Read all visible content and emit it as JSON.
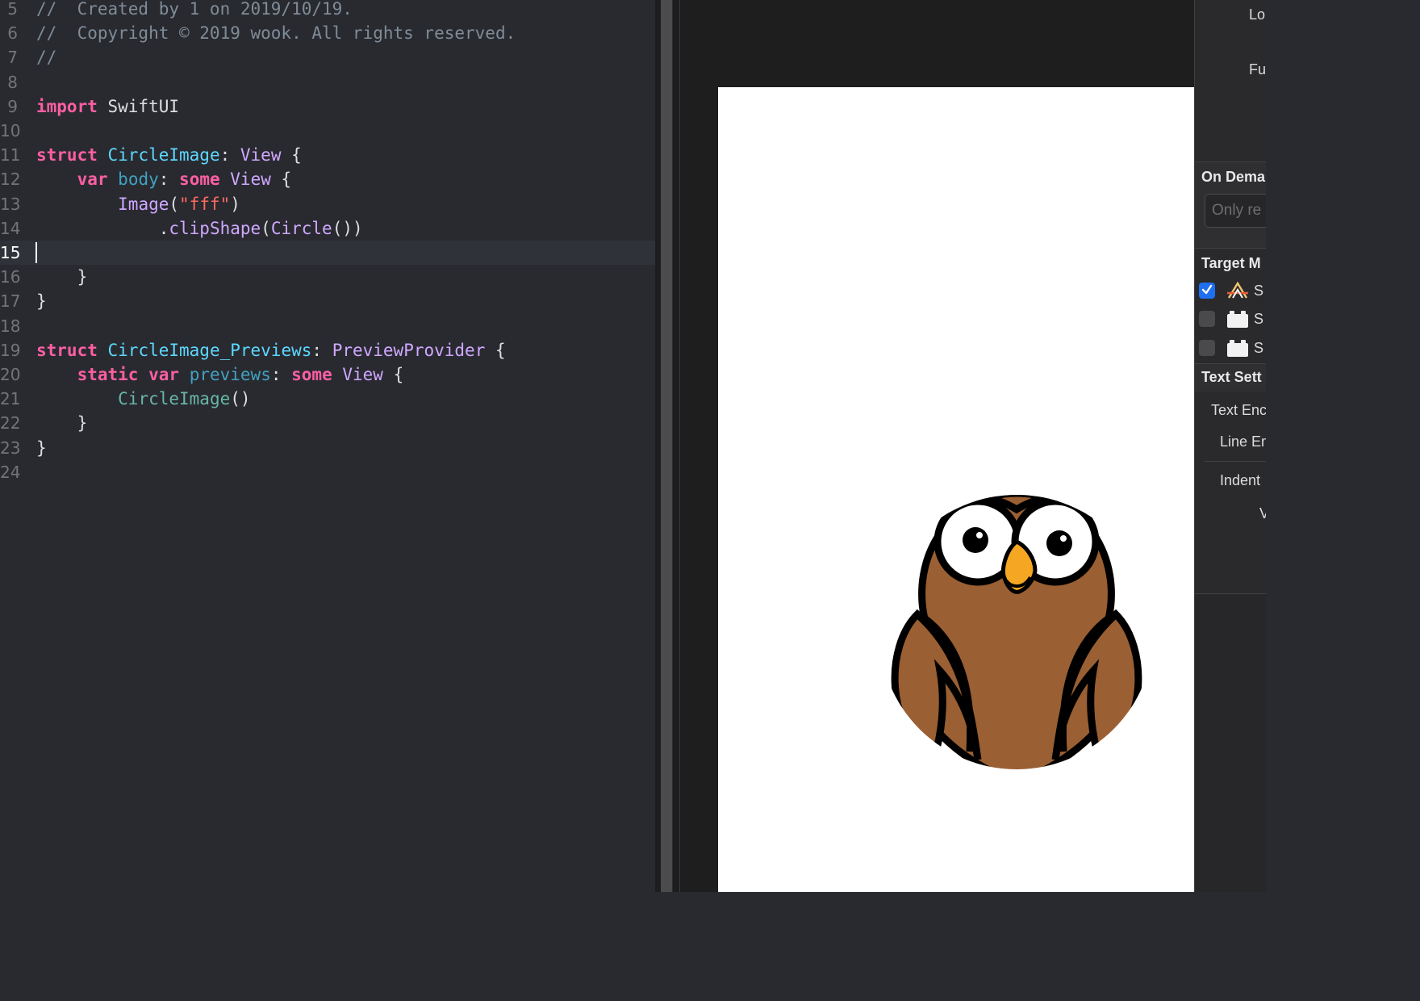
{
  "editor": {
    "current_line": "15",
    "lines": [
      {
        "num": "5",
        "tokens": [
          {
            "t": "//  Created by 1 on 2019/10/19.",
            "c": "comment"
          }
        ]
      },
      {
        "num": "6",
        "tokens": [
          {
            "t": "//  Copyright © 2019 wook. All rights reserved.",
            "c": "comment"
          }
        ]
      },
      {
        "num": "7",
        "tokens": [
          {
            "t": "//",
            "c": "comment"
          }
        ]
      },
      {
        "num": "8",
        "tokens": []
      },
      {
        "num": "9",
        "tokens": [
          {
            "t": "import",
            "c": "kw"
          },
          {
            "t": " SwiftUI",
            "c": "plain"
          }
        ]
      },
      {
        "num": "10",
        "tokens": []
      },
      {
        "num": "11",
        "tokens": [
          {
            "t": "struct",
            "c": "kw"
          },
          {
            "t": " ",
            "c": "plain"
          },
          {
            "t": "CircleImage",
            "c": "type"
          },
          {
            "t": ": ",
            "c": "plain"
          },
          {
            "t": "View",
            "c": "sys"
          },
          {
            "t": " {",
            "c": "plain"
          }
        ]
      },
      {
        "num": "12",
        "tokens": [
          {
            "t": "    ",
            "c": "plain"
          },
          {
            "t": "var",
            "c": "kw"
          },
          {
            "t": " ",
            "c": "plain"
          },
          {
            "t": "body",
            "c": "prop"
          },
          {
            "t": ": ",
            "c": "plain"
          },
          {
            "t": "some",
            "c": "kw"
          },
          {
            "t": " ",
            "c": "plain"
          },
          {
            "t": "View",
            "c": "sys"
          },
          {
            "t": " {",
            "c": "plain"
          }
        ]
      },
      {
        "num": "13",
        "tokens": [
          {
            "t": "        ",
            "c": "plain"
          },
          {
            "t": "Image",
            "c": "sys"
          },
          {
            "t": "(",
            "c": "plain"
          },
          {
            "t": "\"fff\"",
            "c": "str"
          },
          {
            "t": ")",
            "c": "plain"
          }
        ]
      },
      {
        "num": "14",
        "tokens": [
          {
            "t": "            .",
            "c": "plain"
          },
          {
            "t": "clipShape",
            "c": "sys"
          },
          {
            "t": "(",
            "c": "plain"
          },
          {
            "t": "Circle",
            "c": "sys"
          },
          {
            "t": "())",
            "c": "plain"
          }
        ]
      },
      {
        "num": "15",
        "tokens": []
      },
      {
        "num": "16",
        "tokens": [
          {
            "t": "    }",
            "c": "plain"
          }
        ]
      },
      {
        "num": "17",
        "tokens": [
          {
            "t": "}",
            "c": "plain"
          }
        ]
      },
      {
        "num": "18",
        "tokens": []
      },
      {
        "num": "19",
        "tokens": [
          {
            "t": "struct",
            "c": "kw"
          },
          {
            "t": " ",
            "c": "plain"
          },
          {
            "t": "CircleImage_Previews",
            "c": "type"
          },
          {
            "t": ": ",
            "c": "plain"
          },
          {
            "t": "PreviewProvider",
            "c": "sys"
          },
          {
            "t": " {",
            "c": "plain"
          }
        ]
      },
      {
        "num": "20",
        "tokens": [
          {
            "t": "    ",
            "c": "plain"
          },
          {
            "t": "static",
            "c": "kw"
          },
          {
            "t": " ",
            "c": "plain"
          },
          {
            "t": "var",
            "c": "kw"
          },
          {
            "t": " ",
            "c": "plain"
          },
          {
            "t": "previews",
            "c": "prop"
          },
          {
            "t": ": ",
            "c": "plain"
          },
          {
            "t": "some",
            "c": "kw"
          },
          {
            "t": " ",
            "c": "plain"
          },
          {
            "t": "View",
            "c": "sys"
          },
          {
            "t": " {",
            "c": "plain"
          }
        ]
      },
      {
        "num": "21",
        "tokens": [
          {
            "t": "        ",
            "c": "plain"
          },
          {
            "t": "CircleImage",
            "c": "call"
          },
          {
            "t": "()",
            "c": "plain"
          }
        ]
      },
      {
        "num": "22",
        "tokens": [
          {
            "t": "    }",
            "c": "plain"
          }
        ]
      },
      {
        "num": "23",
        "tokens": [
          {
            "t": "}",
            "c": "plain"
          }
        ]
      },
      {
        "num": "24",
        "tokens": []
      }
    ]
  },
  "preview": {
    "image_name": "owl-image",
    "background": "#ffffff"
  },
  "inspector": {
    "top_labels": {
      "location": "Lo",
      "full_path": "Fu"
    },
    "on_demand": {
      "title": "On Dema",
      "placeholder": "Only re"
    },
    "target_membership": {
      "title": "Target M",
      "targets": [
        {
          "checked": true,
          "name": "S",
          "icon": "app-target-icon"
        },
        {
          "checked": false,
          "name": "S",
          "icon": "test-bundle-icon"
        },
        {
          "checked": false,
          "name": "S",
          "icon": "test-bundle-icon"
        }
      ]
    },
    "text_settings": {
      "title": "Text Sett",
      "text_encoding": "Text Enc",
      "line_endings": "Line En",
      "indent": "Indent",
      "widths": "V"
    }
  },
  "colors": {
    "editor_bg": "#292a30",
    "keyword": "#fc5fa3",
    "type_decl": "#5dd8ff",
    "system_type": "#d0a8ff",
    "string": "#fc6a5d",
    "comment": "#7f8c98",
    "checkbox_on": "#1f6ff0"
  }
}
